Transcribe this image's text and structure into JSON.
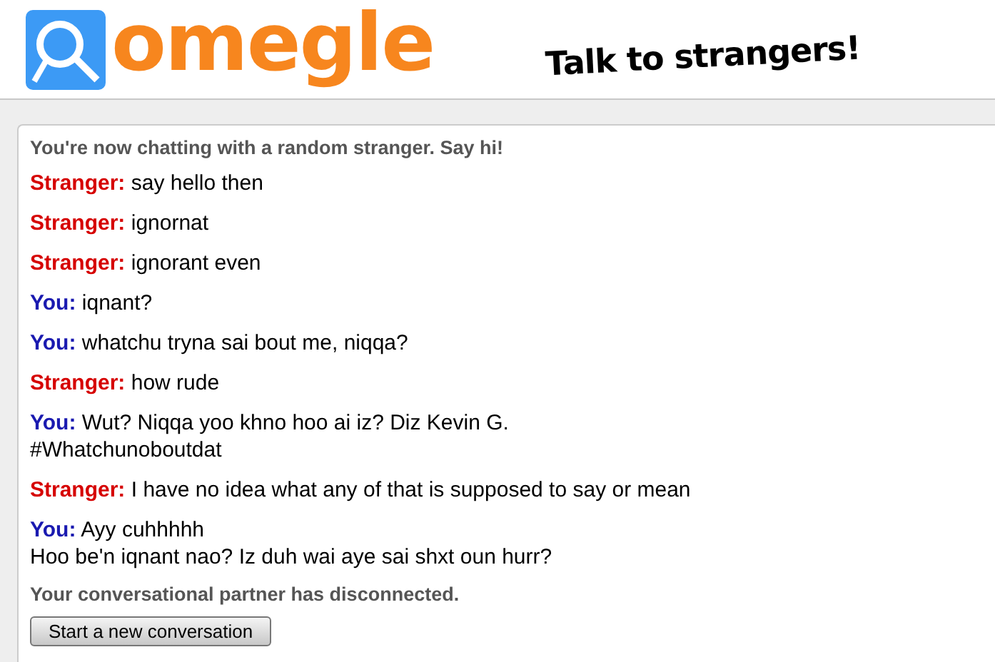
{
  "header": {
    "logo": "omegle",
    "tagline": "Talk to strangers!"
  },
  "log": {
    "status_start": "You're now chatting with a random stranger. Say hi!",
    "messages": [
      {
        "kind": "stranger",
        "sender": "Stranger:",
        "text": "say hello then"
      },
      {
        "kind": "stranger",
        "sender": "Stranger:",
        "text": "ignornat"
      },
      {
        "kind": "stranger",
        "sender": "Stranger:",
        "text": "ignorant even"
      },
      {
        "kind": "you",
        "sender": "You:",
        "text": "iqnant?"
      },
      {
        "kind": "you",
        "sender": "You:",
        "text": "whatchu tryna sai bout me, niqqa?"
      },
      {
        "kind": "stranger",
        "sender": "Stranger:",
        "text": "how rude"
      },
      {
        "kind": "you",
        "sender": "You:",
        "text": "Wut? Niqqa yoo khno hoo ai iz? Diz Kevin G.\n#Whatchunoboutdat"
      },
      {
        "kind": "stranger",
        "sender": "Stranger:",
        "text": "I have no idea what any of that is supposed to say or mean"
      },
      {
        "kind": "you",
        "sender": "You:",
        "text": "Ayy cuhhhhh\nHoo be'n iqnant nao? Iz duh wai aye sai shxt oun hurr?"
      }
    ],
    "status_end": "Your conversational partner has disconnected.",
    "new_button": "Start a new conversation"
  }
}
